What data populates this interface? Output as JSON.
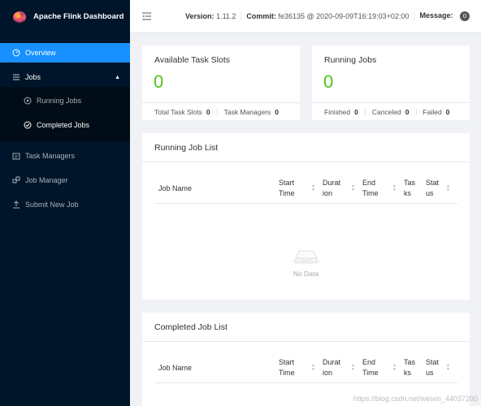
{
  "brand": {
    "title": "Apache Flink Dashboard"
  },
  "sidebar": {
    "items": [
      {
        "label": "Overview",
        "icon": "dashboard-icon"
      },
      {
        "label": "Jobs",
        "icon": "jobs-list-icon"
      },
      {
        "label": "Running Jobs",
        "icon": "play-circle-icon"
      },
      {
        "label": "Completed Jobs",
        "icon": "check-circle-icon"
      },
      {
        "label": "Task Managers",
        "icon": "schedule-icon"
      },
      {
        "label": "Job Manager",
        "icon": "cluster-icon"
      },
      {
        "label": "Submit New Job",
        "icon": "upload-icon"
      }
    ]
  },
  "header": {
    "version_label": "Version:",
    "version_value": "1.11.2",
    "commit_label": "Commit:",
    "commit_value": "fe36135 @ 2020-09-09T16:19:03+02:00",
    "message_label": "Message:",
    "message_count": "0"
  },
  "slots_card": {
    "title": "Available Task Slots",
    "value": "0",
    "total_label": "Total Task Slots",
    "total_value": "0",
    "tm_label": "Task Managers",
    "tm_value": "0"
  },
  "jobs_card": {
    "title": "Running Jobs",
    "value": "0",
    "finished_label": "Finished",
    "finished_value": "0",
    "canceled_label": "Canceled",
    "canceled_value": "0",
    "failed_label": "Failed",
    "failed_value": "0"
  },
  "running_list": {
    "title": "Running Job List",
    "columns": [
      "Job Name",
      "Start\nTime",
      "Durat\nion",
      "End\nTime",
      "Tas\nks",
      "Stat\nus"
    ],
    "empty_text": "No Data"
  },
  "completed_list": {
    "title": "Completed Job List",
    "columns": [
      "Job Name",
      "Start\nTime",
      "Durat\nion",
      "End\nTime",
      "Tas\nks",
      "Stat\nus"
    ]
  },
  "watermark": "https://blog.csdn.net/weixin_44037200",
  "colors": {
    "sidebar_bg": "#001529",
    "accent": "#1890ff",
    "value_green": "#52c41a"
  }
}
